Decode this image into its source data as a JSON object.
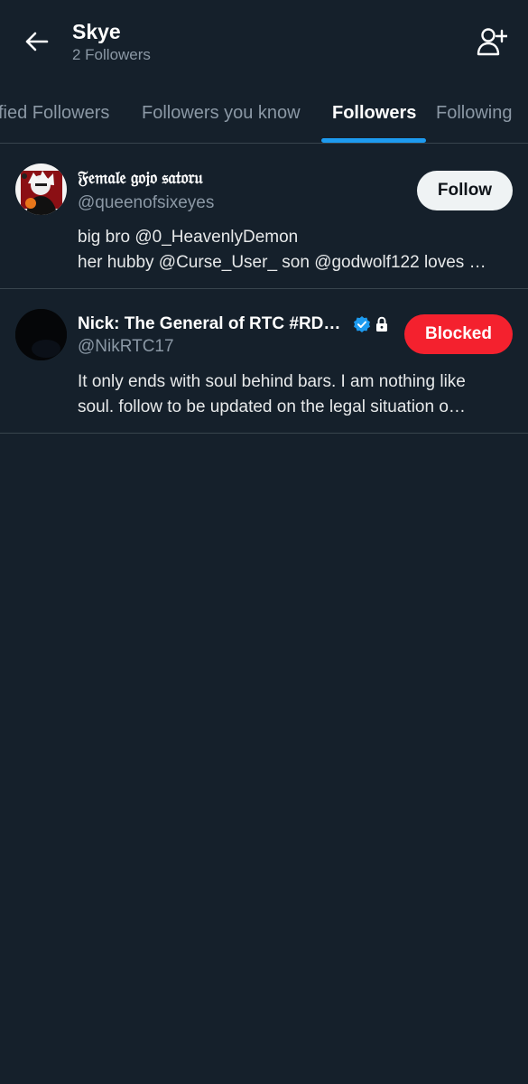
{
  "header": {
    "title": "Skye",
    "subtitle": "2 Followers",
    "back_icon": "arrow-left-icon",
    "add_icon": "add-user-icon"
  },
  "tabs": [
    {
      "label": "Verified Followers",
      "visible_label": "fied Followers",
      "active": false
    },
    {
      "label": "Followers you know",
      "active": false
    },
    {
      "label": "Followers",
      "active": true
    },
    {
      "label": "Following",
      "active": false
    }
  ],
  "colors": {
    "background": "#15202b",
    "accent": "#1d9bf0",
    "blocked": "#f4212e",
    "secondary_text": "#8b98a5"
  },
  "users": [
    {
      "display_name": "𝔉𝔢𝔪𝔞𝔩𝔢 𝔤𝔬𝔧𝔬 𝔰𝔞𝔱𝔬𝔯𝔲",
      "handle": "@queenofsixeyes",
      "button_label": "Follow",
      "bio_lines": [
        "big bro @0_HeavenlyDemon",
        "her hubby @Curse_User_ son @godwolf122 loves …"
      ]
    },
    {
      "display_name": "Nick: The General of RTC #RD…",
      "handle": "@NikRTC17",
      "verified": true,
      "protected": true,
      "button_label": "Blocked",
      "bio_lines": [
        "It only ends with soul behind bars. I am nothing like",
        "soul. follow to be updated on the legal situation o…"
      ]
    }
  ]
}
